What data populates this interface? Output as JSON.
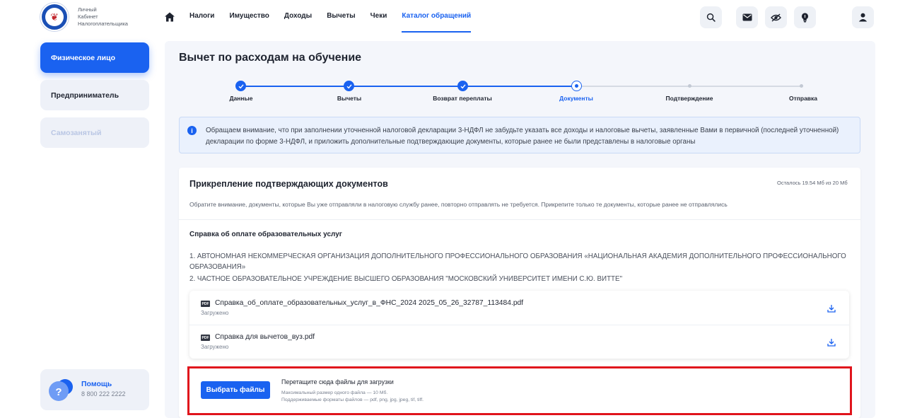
{
  "header": {
    "brand_lines": [
      "Личный",
      "Кабинет",
      "Налогоплательщика"
    ],
    "nav": [
      {
        "label": "Налоги"
      },
      {
        "label": "Имущество"
      },
      {
        "label": "Доходы"
      },
      {
        "label": "Вычеты"
      },
      {
        "label": "Чеки"
      },
      {
        "label": "Каталог обращений",
        "active": true
      }
    ],
    "icons": [
      "search-icon",
      "mail-icon",
      "eye-off-icon",
      "lightbulb-icon",
      "user-icon"
    ]
  },
  "sidebar": {
    "items": [
      {
        "label": "Физическое лицо",
        "state": "active"
      },
      {
        "label": "Предприниматель",
        "state": "normal"
      },
      {
        "label": "Самозанятый",
        "state": "disabled"
      }
    ],
    "help": {
      "title": "Помощь",
      "phone": "8 800 222 2222"
    }
  },
  "page": {
    "title": "Вычет по расходам на обучение",
    "steps": [
      {
        "label": "Данные",
        "status": "done"
      },
      {
        "label": "Вычеты",
        "status": "done"
      },
      {
        "label": "Возврат переплаты",
        "status": "done"
      },
      {
        "label": "Документы",
        "status": "current"
      },
      {
        "label": "Подтверждение",
        "status": "pending"
      },
      {
        "label": "Отправка",
        "status": "pending"
      }
    ],
    "notice": "Обращаем внимание, что при заполнении уточненной налоговой декларации 3-НДФЛ не забудьте указать все доходы и налоговые вычеты, заявленные Вами в первичной (последней уточненной) декларации по форме 3-НДФЛ, и приложить дополнительные подтверждающие документы, которые ранее не были представлены в налоговые органы"
  },
  "attach": {
    "title": "Прикрепление подтверждающих документов",
    "remaining": "Осталось 19.54 Мб из 20 Мб",
    "subtitle": "Обратите внимание, документы, которые Вы уже отправляли в налоговую службу ранее, повторно отправлять не требуется. Прикрепите только те документы, которые ранее не отправлялись",
    "section_title": "Справка об оплате образовательных услуг",
    "institutions": [
      "1. АВТОНОМНАЯ НЕКОММЕРЧЕСКАЯ ОРГАНИЗАЦИЯ ДОПОЛНИТЕЛЬНОГО ПРОФЕССИОНАЛЬНОГО ОБРАЗОВАНИЯ «НАЦИОНАЛЬНАЯ АКАДЕМИЯ ДОПОЛНИТЕЛЬНОГО ПРОФЕССИОНАЛЬНОГО ОБРАЗОВАНИЯ»",
      "2. ЧАСТНОЕ ОБРАЗОВАТЕЛЬНОЕ УЧРЕЖДЕНИЕ ВЫСШЕГО ОБРАЗОВАНИЯ \"МОСКОВСКИЙ УНИВЕРСИТЕТ ИМЕНИ С.Ю. ВИТТЕ\""
    ],
    "files": [
      {
        "type": "PDF",
        "name": "Справка_об_оплате_образовательных_услуг_в_ФНС_2024 2025_05_26_32787_113484.pdf",
        "status": "Загружено"
      },
      {
        "type": "PDF",
        "name": "Справка для вычетов_вуз.pdf",
        "status": "Загружено"
      }
    ],
    "upload": {
      "button": "Выбрать файлы",
      "title": "Перетащите сюда файлы для загрузки",
      "hint_size": "Максимальный размер одного файла — 10 Мб.",
      "hint_formats": "Поддерживаемые форматы файлов — pdf, png, jpg, jpeg, tif, tiff."
    }
  },
  "colors": {
    "accent": "#1a62f0",
    "highlight_border": "#e0141c",
    "panel_bg": "#f4f6fb"
  }
}
